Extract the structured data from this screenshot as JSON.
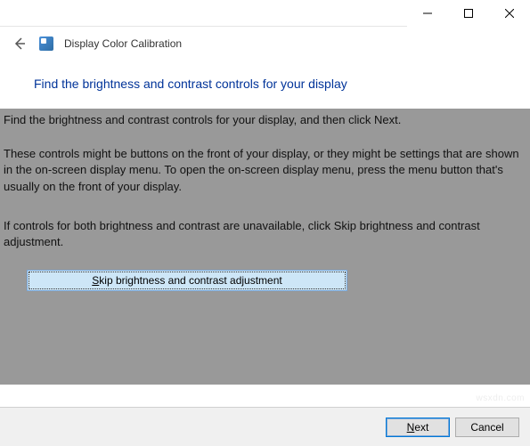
{
  "titlebar": {
    "minimize_icon": "minimize-icon",
    "maximize_icon": "maximize-icon",
    "close_icon": "close-icon"
  },
  "header": {
    "app_title": "Display Color Calibration"
  },
  "heading": "Find the brightness and contrast controls for your display",
  "content": {
    "para1": "Find the brightness and contrast controls for your display, and then click Next.",
    "para2": "These controls might be buttons on the front of your display, or they might be settings that are shown in the on-screen display menu. To open the on-screen display menu, press the menu button that's usually on the front of your display.",
    "para3": "If controls for both brightness and contrast are unavailable, click Skip brightness and contrast adjustment.",
    "skip_prefix": "S",
    "skip_rest": "kip brightness and contrast adjustment"
  },
  "footer": {
    "next_prefix": "N",
    "next_rest": "ext",
    "cancel_label": "Cancel"
  },
  "watermark": "wsxdn.com"
}
